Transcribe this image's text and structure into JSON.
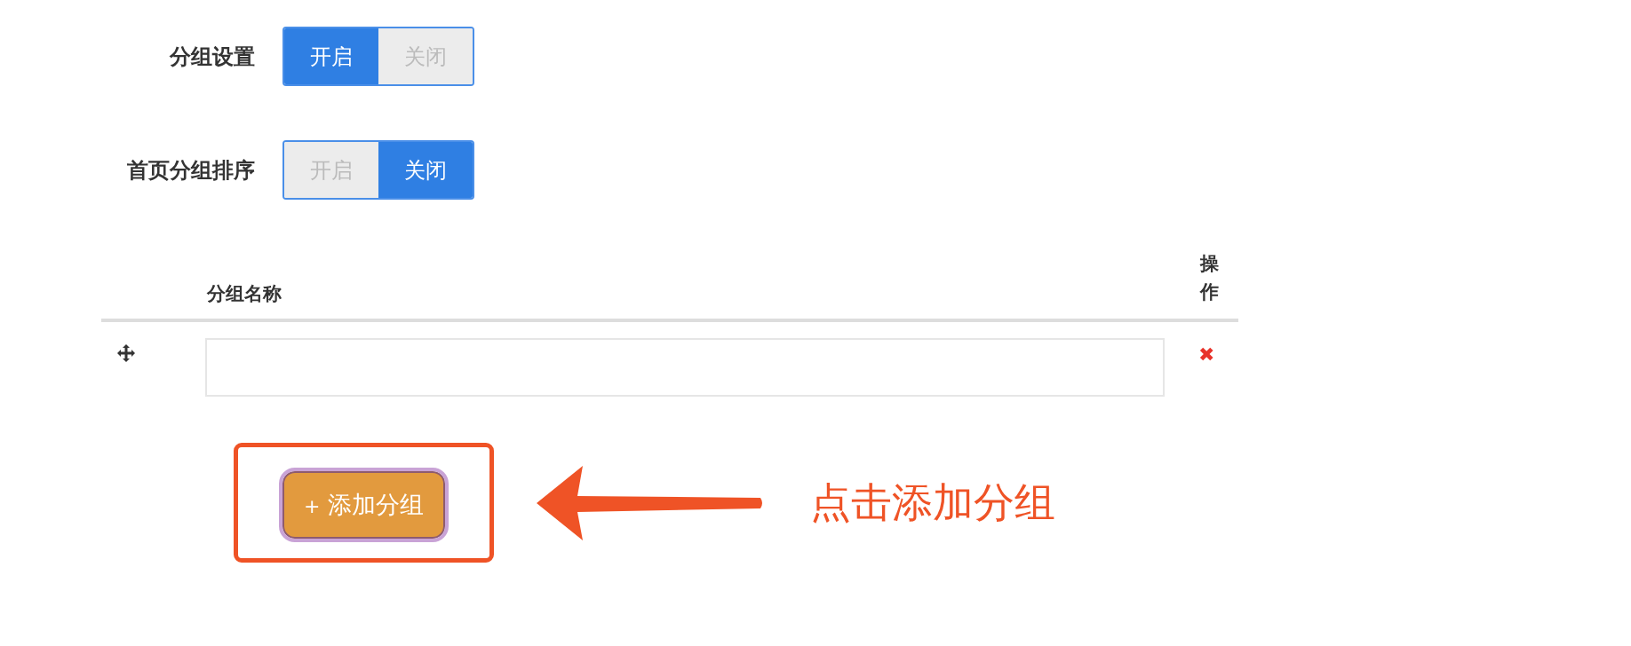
{
  "settings": [
    {
      "label": "分组设置",
      "options": [
        {
          "label": "开启",
          "selected": true
        },
        {
          "label": "关闭",
          "selected": false
        }
      ]
    },
    {
      "label": "首页分组排序",
      "options": [
        {
          "label": "开启",
          "selected": false
        },
        {
          "label": "关闭",
          "selected": true
        }
      ]
    }
  ],
  "table": {
    "columns": [
      "分组名称",
      "操作"
    ],
    "rows": [
      {
        "delete": "✖"
      }
    ]
  },
  "add_button": {
    "icon": "+",
    "label": "添加分组"
  },
  "annotation": {
    "text": "点击添加分组"
  }
}
